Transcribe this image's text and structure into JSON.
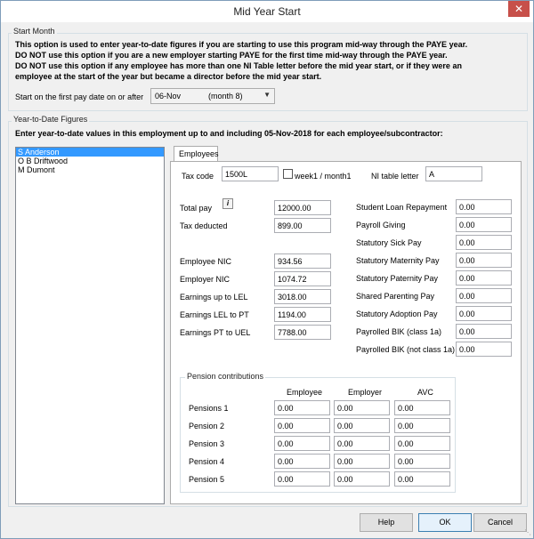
{
  "window": {
    "title": "Mid Year Start",
    "close_glyph": "✕"
  },
  "start_month": {
    "group_label": "Start Month",
    "info_lines": [
      "This option is used to enter year-to-date figures if you are starting to use this program mid-way through the PAYE year.",
      "DO NOT use this option if you are a new employer starting PAYE for the first time mid-way through the PAYE year.",
      "DO NOT use this option if any employee has more than one NI Table letter before the mid year start, or if they were an",
      "employee at the start of the year but became a director before the mid year start."
    ],
    "first_pay_label": "Start on the first pay date on or after",
    "first_pay_date": "06-Nov",
    "first_pay_month": "(month 8)"
  },
  "ytd": {
    "group_label": "Year-to-Date Figures",
    "heading": "Enter year-to-date values in this employment up to and including 05-Nov-2018 for each employee/subcontractor:",
    "employees": [
      {
        "name": "S Anderson",
        "selected": true
      },
      {
        "name": "O B Driftwood",
        "selected": false
      },
      {
        "name": "M Dumont",
        "selected": false
      }
    ],
    "tab_label": "Employees",
    "tax_code_label": "Tax code",
    "tax_code_value": "1500L",
    "week1_label": "week1 / month1",
    "ni_letter_label": "NI table letter",
    "ni_letter_value": "A",
    "info_glyph": "i",
    "left_fields": [
      {
        "label": "Total pay",
        "value": "12000.00"
      },
      {
        "label": "Tax deducted",
        "value": "899.00"
      },
      {
        "label": "Employee NIC",
        "value": "934.56"
      },
      {
        "label": "Employer NIC",
        "value": "1074.72"
      },
      {
        "label": "Earnings up to LEL",
        "value": "3018.00"
      },
      {
        "label": "Earnings LEL to PT",
        "value": "1194.00"
      },
      {
        "label": "Earnings PT to UEL",
        "value": "7788.00"
      }
    ],
    "right_fields": [
      {
        "label": "Student Loan Repayment",
        "value": "0.00"
      },
      {
        "label": "Payroll Giving",
        "value": "0.00"
      },
      {
        "label": "Statutory Sick Pay",
        "value": "0.00"
      },
      {
        "label": "Statutory Maternity Pay",
        "value": "0.00"
      },
      {
        "label": "Statutory Paternity Pay",
        "value": "0.00"
      },
      {
        "label": "Shared Parenting Pay",
        "value": "0.00"
      },
      {
        "label": "Statutory Adoption Pay",
        "value": "0.00"
      },
      {
        "label": "Payrolled BIK (class 1a)",
        "value": "0.00"
      },
      {
        "label": "Payrolled BIK (not class 1a)",
        "value": "0.00"
      }
    ],
    "pension": {
      "group_label": "Pension contributions",
      "columns": [
        "Employee",
        "Employer",
        "AVC"
      ],
      "rows": [
        {
          "label": "Pensions 1",
          "values": [
            "0.00",
            "0.00",
            "0.00"
          ]
        },
        {
          "label": "Pension 2",
          "values": [
            "0.00",
            "0.00",
            "0.00"
          ]
        },
        {
          "label": "Pension 3",
          "values": [
            "0.00",
            "0.00",
            "0.00"
          ]
        },
        {
          "label": "Pension 4",
          "values": [
            "0.00",
            "0.00",
            "0.00"
          ]
        },
        {
          "label": "Pension 5",
          "values": [
            "0.00",
            "0.00",
            "0.00"
          ]
        }
      ]
    }
  },
  "buttons": {
    "help": "Help",
    "ok": "OK",
    "cancel": "Cancel"
  }
}
